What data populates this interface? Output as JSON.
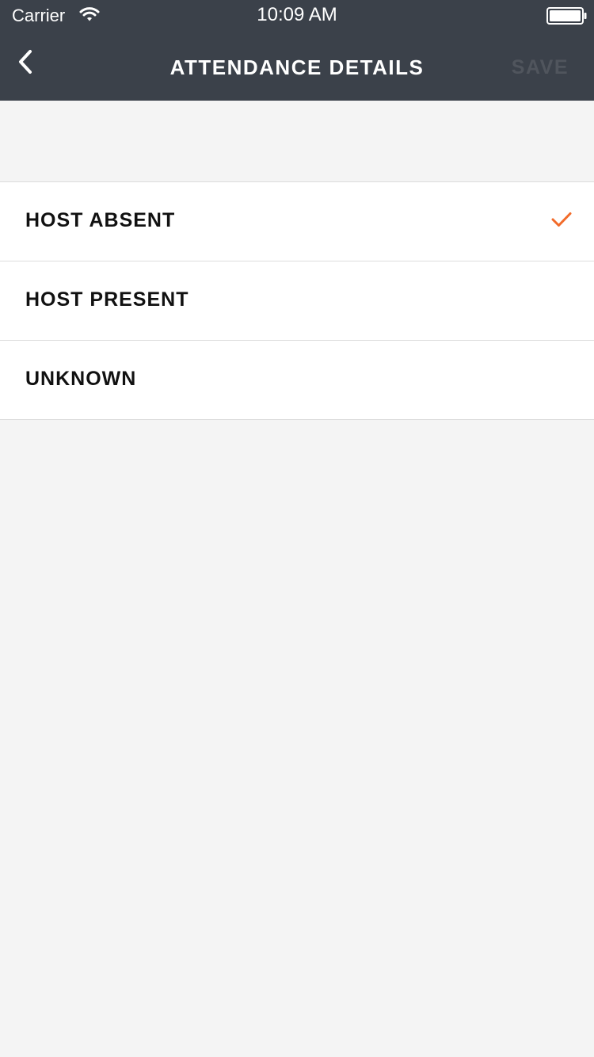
{
  "status_bar": {
    "carrier": "Carrier",
    "time": "10:09 AM"
  },
  "nav": {
    "title": "ATTENDANCE DETAILS",
    "save_label": "SAVE",
    "back_icon": "chevron-left-icon"
  },
  "options": [
    {
      "label": "HOST ABSENT",
      "selected": true
    },
    {
      "label": "HOST PRESENT",
      "selected": false
    },
    {
      "label": "UNKNOWN",
      "selected": false
    }
  ],
  "colors": {
    "header_bg": "#3b414a",
    "accent": "#f26b2a",
    "page_bg": "#f4f4f4",
    "save_disabled": "#50555d"
  }
}
